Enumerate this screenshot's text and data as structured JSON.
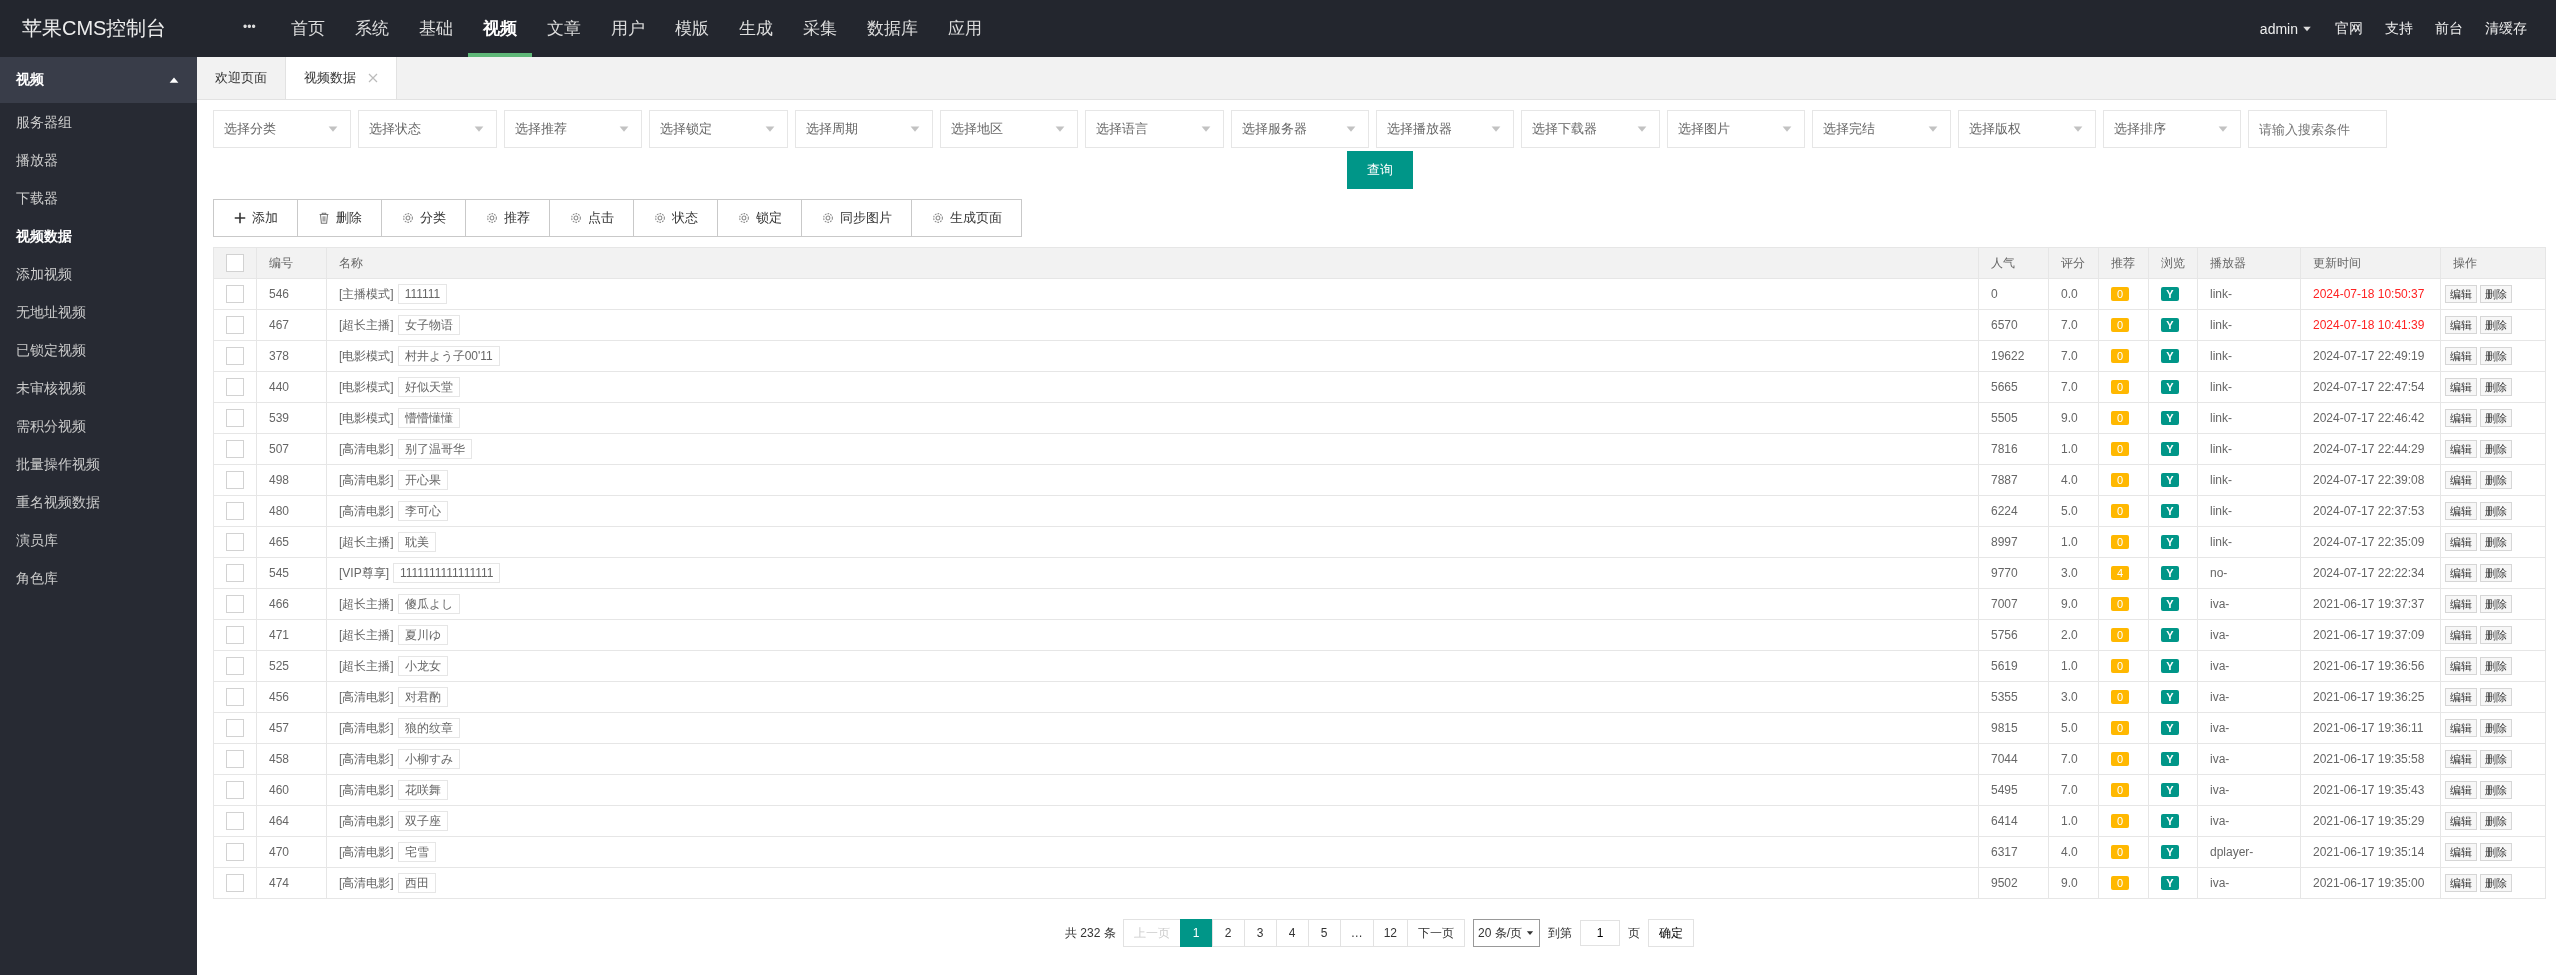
{
  "header": {
    "logo": "苹果CMS控制台",
    "more": "•••",
    "nav": [
      {
        "label": "首页",
        "selected": false
      },
      {
        "label": "系统",
        "selected": false
      },
      {
        "label": "基础",
        "selected": false
      },
      {
        "label": "视频",
        "selected": true
      },
      {
        "label": "文章",
        "selected": false
      },
      {
        "label": "用户",
        "selected": false
      },
      {
        "label": "模版",
        "selected": false
      },
      {
        "label": "生成",
        "selected": false
      },
      {
        "label": "采集",
        "selected": false
      },
      {
        "label": "数据库",
        "selected": false
      },
      {
        "label": "应用",
        "selected": false
      }
    ],
    "user": "admin",
    "links": [
      "官网",
      "支持",
      "前台",
      "清缓存"
    ]
  },
  "sidebar": {
    "title": "视频",
    "expanded": true,
    "items": [
      {
        "label": "服务器组",
        "selected": false
      },
      {
        "label": "播放器",
        "selected": false
      },
      {
        "label": "下载器",
        "selected": false
      },
      {
        "label": "视频数据",
        "selected": true
      },
      {
        "label": "添加视频",
        "selected": false
      },
      {
        "label": "无地址视频",
        "selected": false
      },
      {
        "label": "已锁定视频",
        "selected": false
      },
      {
        "label": "未审核视频",
        "selected": false
      },
      {
        "label": "需积分视频",
        "selected": false
      },
      {
        "label": "批量操作视频",
        "selected": false
      },
      {
        "label": "重名视频数据",
        "selected": false
      },
      {
        "label": "演员库",
        "selected": false
      },
      {
        "label": "角色库",
        "selected": false
      }
    ]
  },
  "tabs": [
    {
      "label": "欢迎页面",
      "selected": false,
      "closable": false
    },
    {
      "label": "视频数据",
      "selected": true,
      "closable": true
    }
  ],
  "filters": [
    "选择分类",
    "选择状态",
    "选择推荐",
    "选择锁定",
    "选择周期",
    "选择地区",
    "选择语言",
    "选择服务器",
    "选择播放器",
    "选择下载器",
    "选择图片",
    "选择完结",
    "选择版权",
    "选择排序"
  ],
  "search": {
    "placeholder": "请输入搜索条件"
  },
  "query_button": "查询",
  "toolbar": [
    {
      "kind": "add",
      "label": "添加"
    },
    {
      "kind": "delete",
      "label": "删除"
    },
    {
      "kind": "gear",
      "label": "分类"
    },
    {
      "kind": "gear",
      "label": "推荐"
    },
    {
      "kind": "gear",
      "label": "点击"
    },
    {
      "kind": "gear",
      "label": "状态"
    },
    {
      "kind": "gear",
      "label": "锁定"
    },
    {
      "kind": "gear",
      "label": "同步图片"
    },
    {
      "kind": "gear",
      "label": "生成页面"
    }
  ],
  "table": {
    "select_all": {
      "checked": false
    },
    "columns": [
      "编号",
      "名称",
      "人气",
      "评分",
      "推荐",
      "浏览",
      "播放器",
      "更新时间",
      "操作"
    ],
    "rows": [
      {
        "checked": false,
        "id": "546",
        "tag": "[主播模式]",
        "name": "111111",
        "hits": "0",
        "score": "0.0",
        "level": "0",
        "browse": "Y",
        "player": "link-",
        "time": "2024-07-18 10:50:37",
        "recent": true,
        "actions": [
          "编辑",
          "删除"
        ]
      },
      {
        "checked": false,
        "id": "467",
        "tag": "[超长主播]",
        "name": "女子物语",
        "hits": "6570",
        "score": "7.0",
        "level": "0",
        "browse": "Y",
        "player": "link-",
        "time": "2024-07-18 10:41:39",
        "recent": true,
        "actions": [
          "编辑",
          "删除"
        ]
      },
      {
        "checked": false,
        "id": "378",
        "tag": "[电影模式]",
        "name": "村井よう子00'11",
        "hits": "19622",
        "score": "7.0",
        "level": "0",
        "browse": "Y",
        "player": "link-",
        "time": "2024-07-17 22:49:19",
        "recent": false,
        "actions": [
          "编辑",
          "删除"
        ]
      },
      {
        "checked": false,
        "id": "440",
        "tag": "[电影模式]",
        "name": "好似天堂",
        "hits": "5665",
        "score": "7.0",
        "level": "0",
        "browse": "Y",
        "player": "link-",
        "time": "2024-07-17 22:47:54",
        "recent": false,
        "actions": [
          "编辑",
          "删除"
        ]
      },
      {
        "checked": false,
        "id": "539",
        "tag": "[电影模式]",
        "name": "懵懵懂懂",
        "hits": "5505",
        "score": "9.0",
        "level": "0",
        "browse": "Y",
        "player": "link-",
        "time": "2024-07-17 22:46:42",
        "recent": false,
        "actions": [
          "编辑",
          "删除"
        ]
      },
      {
        "checked": false,
        "id": "507",
        "tag": "[高清电影]",
        "name": "别了温哥华",
        "hits": "7816",
        "score": "1.0",
        "level": "0",
        "browse": "Y",
        "player": "link-",
        "time": "2024-07-17 22:44:29",
        "recent": false,
        "actions": [
          "编辑",
          "删除"
        ]
      },
      {
        "checked": false,
        "id": "498",
        "tag": "[高清电影]",
        "name": "开心果",
        "hits": "7887",
        "score": "4.0",
        "level": "0",
        "browse": "Y",
        "player": "link-",
        "time": "2024-07-17 22:39:08",
        "recent": false,
        "actions": [
          "编辑",
          "删除"
        ]
      },
      {
        "checked": false,
        "id": "480",
        "tag": "[高清电影]",
        "name": "李可心",
        "hits": "6224",
        "score": "5.0",
        "level": "0",
        "browse": "Y",
        "player": "link-",
        "time": "2024-07-17 22:37:53",
        "recent": false,
        "actions": [
          "编辑",
          "删除"
        ]
      },
      {
        "checked": false,
        "id": "465",
        "tag": "[超长主播]",
        "name": "耽美",
        "hits": "8997",
        "score": "1.0",
        "level": "0",
        "browse": "Y",
        "player": "link-",
        "time": "2024-07-17 22:35:09",
        "recent": false,
        "actions": [
          "编辑",
          "删除"
        ]
      },
      {
        "checked": false,
        "id": "545",
        "tag": "[VIP尊享]",
        "name": "1111111111111111",
        "hits": "9770",
        "score": "3.0",
        "level": "4",
        "browse": "Y",
        "player": "no-",
        "time": "2024-07-17 22:22:34",
        "recent": false,
        "actions": [
          "编辑",
          "删除"
        ]
      },
      {
        "checked": false,
        "id": "466",
        "tag": "[超长主播]",
        "name": "傻瓜よし",
        "hits": "7007",
        "score": "9.0",
        "level": "0",
        "browse": "Y",
        "player": "iva-",
        "time": "2021-06-17 19:37:37",
        "recent": false,
        "actions": [
          "编辑",
          "删除"
        ]
      },
      {
        "checked": false,
        "id": "471",
        "tag": "[超长主播]",
        "name": "夏川ゆ",
        "hits": "5756",
        "score": "2.0",
        "level": "0",
        "browse": "Y",
        "player": "iva-",
        "time": "2021-06-17 19:37:09",
        "recent": false,
        "actions": [
          "编辑",
          "删除"
        ]
      },
      {
        "checked": false,
        "id": "525",
        "tag": "[超长主播]",
        "name": "小龙女",
        "hits": "5619",
        "score": "1.0",
        "level": "0",
        "browse": "Y",
        "player": "iva-",
        "time": "2021-06-17 19:36:56",
        "recent": false,
        "actions": [
          "编辑",
          "删除"
        ]
      },
      {
        "checked": false,
        "id": "456",
        "tag": "[高清电影]",
        "name": "对君酌",
        "hits": "5355",
        "score": "3.0",
        "level": "0",
        "browse": "Y",
        "player": "iva-",
        "time": "2021-06-17 19:36:25",
        "recent": false,
        "actions": [
          "编辑",
          "删除"
        ]
      },
      {
        "checked": false,
        "id": "457",
        "tag": "[高清电影]",
        "name": "狼的纹章",
        "hits": "9815",
        "score": "5.0",
        "level": "0",
        "browse": "Y",
        "player": "iva-",
        "time": "2021-06-17 19:36:11",
        "recent": false,
        "actions": [
          "编辑",
          "删除"
        ]
      },
      {
        "checked": false,
        "id": "458",
        "tag": "[高清电影]",
        "name": "小柳すみ",
        "hits": "7044",
        "score": "7.0",
        "level": "0",
        "browse": "Y",
        "player": "iva-",
        "time": "2021-06-17 19:35:58",
        "recent": false,
        "actions": [
          "编辑",
          "删除"
        ]
      },
      {
        "checked": false,
        "id": "460",
        "tag": "[高清电影]",
        "name": "花咲舞",
        "hits": "5495",
        "score": "7.0",
        "level": "0",
        "browse": "Y",
        "player": "iva-",
        "time": "2021-06-17 19:35:43",
        "recent": false,
        "actions": [
          "编辑",
          "删除"
        ]
      },
      {
        "checked": false,
        "id": "464",
        "tag": "[高清电影]",
        "name": "双子座",
        "hits": "6414",
        "score": "1.0",
        "level": "0",
        "browse": "Y",
        "player": "iva-",
        "time": "2021-06-17 19:35:29",
        "recent": false,
        "actions": [
          "编辑",
          "删除"
        ]
      },
      {
        "checked": false,
        "id": "470",
        "tag": "[高清电影]",
        "name": "宅雪",
        "hits": "6317",
        "score": "4.0",
        "level": "0",
        "browse": "Y",
        "player": "dplayer-",
        "time": "2021-06-17 19:35:14",
        "recent": false,
        "actions": [
          "编辑",
          "删除"
        ]
      },
      {
        "checked": false,
        "id": "474",
        "tag": "[高清电影]",
        "name": "西田",
        "hits": "9502",
        "score": "9.0",
        "level": "0",
        "browse": "Y",
        "player": "iva-",
        "time": "2021-06-17 19:35:00",
        "recent": false,
        "actions": [
          "编辑",
          "删除"
        ]
      }
    ]
  },
  "pagination": {
    "total": "共 232 条",
    "prev": {
      "label": "上一页",
      "disabled": true
    },
    "pages": [
      {
        "label": "1",
        "selected": true
      },
      {
        "label": "2",
        "selected": false
      },
      {
        "label": "3",
        "selected": false
      },
      {
        "label": "4",
        "selected": false
      },
      {
        "label": "5",
        "selected": false
      },
      {
        "label": "…",
        "selected": false
      },
      {
        "label": "12",
        "selected": false
      }
    ],
    "next": {
      "label": "下一页",
      "disabled": false
    },
    "per_page": "20 条/页",
    "goto_label": "到第",
    "goto_value": "1",
    "page_unit": "页",
    "confirm": "确定"
  }
}
